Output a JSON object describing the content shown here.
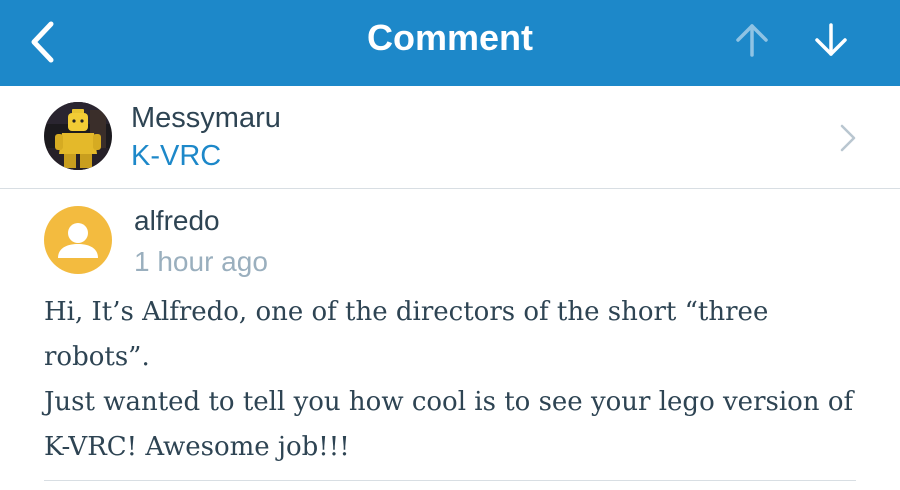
{
  "header": {
    "title": "Comment",
    "back_icon": "back-chevron-icon",
    "prev_icon": "arrow-up-icon",
    "next_icon": "arrow-down-icon",
    "background": "#1d88c9"
  },
  "site": {
    "name": "Messymaru",
    "blog": "K-VRC",
    "avatar_icon": "lego-figure-avatar",
    "chevron_icon": "chevron-right-icon"
  },
  "comment": {
    "author": "alfredo",
    "time": "1 hour ago",
    "avatar_icon": "default-user-icon",
    "avatar_color": "#f3bb3f",
    "lines": [
      "Hi, It’s Alfredo, one of the directors of the short “three robots”.",
      "Just wanted to tell you how cool is to see your lego version of K-VRC! Awesome job!!!"
    ]
  }
}
